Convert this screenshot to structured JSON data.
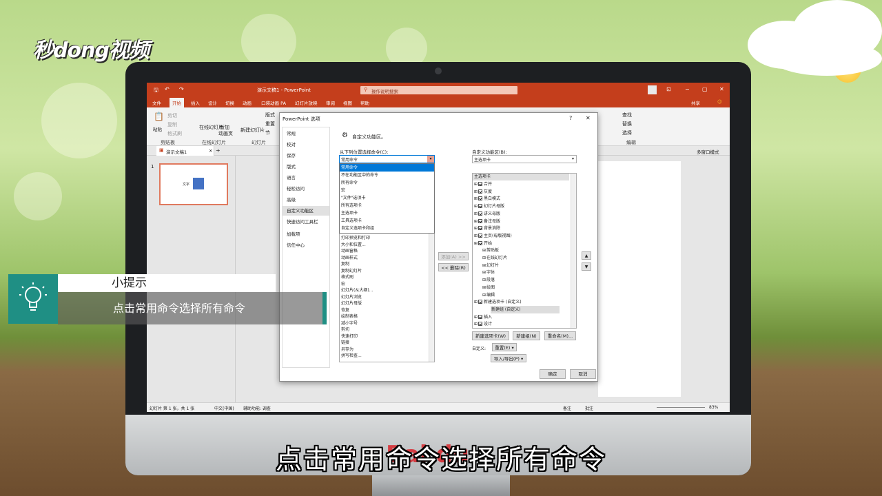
{
  "brand": {
    "logo_text": "秒dong视频"
  },
  "app": {
    "title": "演示文稿1  -  PowerPoint",
    "search_placeholder": "操作说明搜索",
    "tabs": [
      "文件",
      "开始",
      "插入",
      "设计",
      "切换",
      "动画",
      "口袋动画 PA",
      "幻灯片放映",
      "审阅",
      "视图",
      "帮助"
    ],
    "login": "共享",
    "ribbon": {
      "paste": "粘贴",
      "cut": "剪切",
      "copy": "复制",
      "format_painter": "格式刷",
      "clipboard": "剪贴板",
      "online_slide": "在线幻灯片",
      "new_slide_line1": "新加",
      "new_slide_line2": "动画页",
      "online_group": "在线幻灯片",
      "new_btn": "新建幻灯片",
      "layout": "版式",
      "reset": "重置",
      "section": "节",
      "slides_group": "幻灯片",
      "find": "查找",
      "replace": "替换",
      "select": "选择",
      "edit_group": "编辑"
    },
    "doc_tab": "演示文稿1",
    "multi_window": "多窗口模式",
    "slide_num": "1",
    "thumb_text": "文字",
    "status_left": "幻灯片 第 1 张，共 1 张",
    "status_lang": "中文(中国)",
    "status_access": "辅助功能: 调查",
    "status_notes": "备注",
    "status_comments": "批注",
    "zoom": "83%"
  },
  "dialog": {
    "title": "PowerPoint 选项",
    "help": "?",
    "close": "✕",
    "nav": [
      "常规",
      "校对",
      "保存",
      "版式",
      "语言",
      "轻松访问",
      "高级",
      "自定义功能区",
      "快速访问工具栏",
      "加载项",
      "信任中心"
    ],
    "heading": "自定义功能区。",
    "left_label": "从下列位置选择命令(C):",
    "left_value": "常用命令",
    "dropdown_options": [
      "常用命令",
      "不在功能区中的命令",
      "所有命令",
      "宏",
      "\"文件\"选项卡",
      "所有选项卡",
      "主选项卡",
      "工具选项卡",
      "自定义选项卡和组"
    ],
    "left_list": [
      "打印预览和打印",
      "大小和位置...",
      "动画窗格",
      "动画样式",
      "复制",
      "复制幻灯片",
      "格式刷",
      "宏",
      "幻灯片(从大纲)...",
      "幻灯片浏览",
      "幻灯片母版",
      "恢复",
      "绘制表格",
      "减小字号",
      "剪切",
      "快速打印",
      "链接",
      "另存为",
      "拼写检查..."
    ],
    "add_btn": "添加(A) >>",
    "remove_btn": "<< 删除(R)",
    "right_label": "自定义功能区(B):",
    "right_value": "主选项卡",
    "tree_header": "主选项卡",
    "tree": [
      {
        "label": "合并",
        "level": 0,
        "check": true
      },
      {
        "label": "灰度",
        "level": 0,
        "check": true
      },
      {
        "label": "黑白模式",
        "level": 0,
        "check": true
      },
      {
        "label": "幻灯片母版",
        "level": 0,
        "check": true
      },
      {
        "label": "讲义母版",
        "level": 0,
        "check": true
      },
      {
        "label": "备注母版",
        "level": 0,
        "check": true
      },
      {
        "label": "背景消除",
        "level": 0,
        "check": true
      },
      {
        "label": "主页(母版视图)",
        "level": 0,
        "check": true
      },
      {
        "label": "开始",
        "level": 0,
        "check": true
      },
      {
        "label": "剪贴板",
        "level": 1,
        "check": false
      },
      {
        "label": "在线幻灯片",
        "level": 1,
        "check": false
      },
      {
        "label": "幻灯片",
        "level": 1,
        "check": false
      },
      {
        "label": "字体",
        "level": 1,
        "check": false
      },
      {
        "label": "段落",
        "level": 1,
        "check": false
      },
      {
        "label": "绘图",
        "level": 1,
        "check": false
      },
      {
        "label": "编辑",
        "level": 1,
        "check": false
      },
      {
        "label": "新建选项卡 (自定义)",
        "level": 0,
        "check": true
      },
      {
        "label": "新建组 (自定义)",
        "level": 2,
        "check": false
      },
      {
        "label": "插入",
        "level": 0,
        "check": true
      },
      {
        "label": "设计",
        "level": 0,
        "check": true
      }
    ],
    "new_tab_btn": "新建选项卡(W)",
    "new_group_btn": "新建组(N)",
    "rename_btn": "重命名(M)...",
    "custom_label": "自定义:",
    "reset_btn": "重置(E) ▾",
    "import_btn": "导入/导出(P) ▾",
    "ok": "确定",
    "cancel": "取消"
  },
  "tip": {
    "head": "小提示",
    "body": "点击常用命令选择所有命令"
  },
  "subtitle": "点击常用命令选择所有命令"
}
